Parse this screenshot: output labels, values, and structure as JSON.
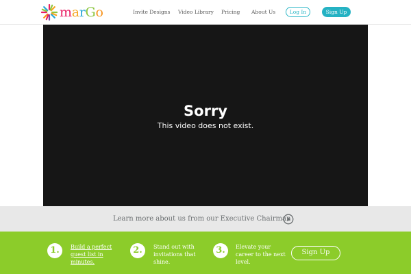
{
  "brand": {
    "name": "marGo",
    "colors": {
      "m": "#e91e63",
      "a": "#f5a623",
      "r": "#2aa7d6",
      "G": "#8cc63f",
      "o": "#f7941d"
    }
  },
  "nav": {
    "items": [
      "Invite Designs",
      "Video Library",
      "Pricing",
      "About Us"
    ],
    "login_label": "Log In",
    "signup_label": "Sign Up"
  },
  "video": {
    "title": "Sorry",
    "message": "This video does not exist."
  },
  "promo": {
    "text": "Learn more about us from our Executive Chairman",
    "icon": "play-icon"
  },
  "steps": [
    {
      "number": "1.",
      "lines": [
        "Build a perfect",
        "guest list in",
        "minutes."
      ]
    },
    {
      "number": "2.",
      "lines": [
        "Stand out with",
        "invitations that",
        "shine."
      ]
    },
    {
      "number": "3.",
      "lines": [
        "Elevate your",
        "career to the next",
        "level."
      ]
    }
  ],
  "cta": {
    "signup_label": "Sign Up"
  },
  "theme": {
    "accent_teal": "#25b2c3",
    "green": "#8ccc2a",
    "video_bg": "#161616",
    "strip_bg": "#e8e8e8"
  }
}
